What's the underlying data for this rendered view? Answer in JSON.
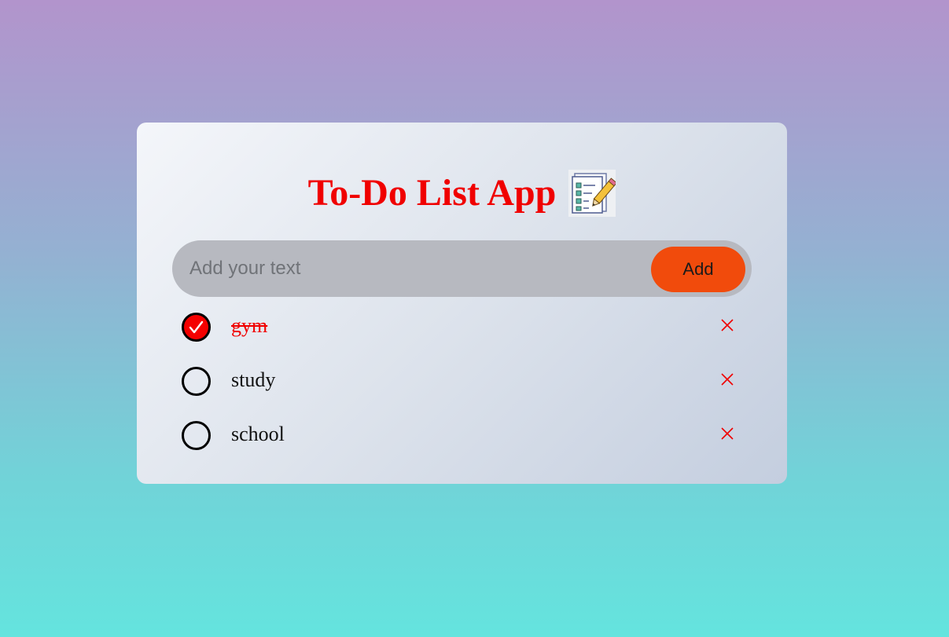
{
  "app": {
    "title": "To-Do List App",
    "title_icon": "checklist-pencil-icon"
  },
  "input": {
    "placeholder": "Add your text",
    "value": "",
    "add_label": "Add"
  },
  "tasks": [
    {
      "label": "gym",
      "done": true
    },
    {
      "label": "study",
      "done": false
    },
    {
      "label": "school",
      "done": false
    }
  ],
  "colors": {
    "accent": "#f00000",
    "add_button": "#f14b0c",
    "input_bg": "#b7b9c0"
  }
}
